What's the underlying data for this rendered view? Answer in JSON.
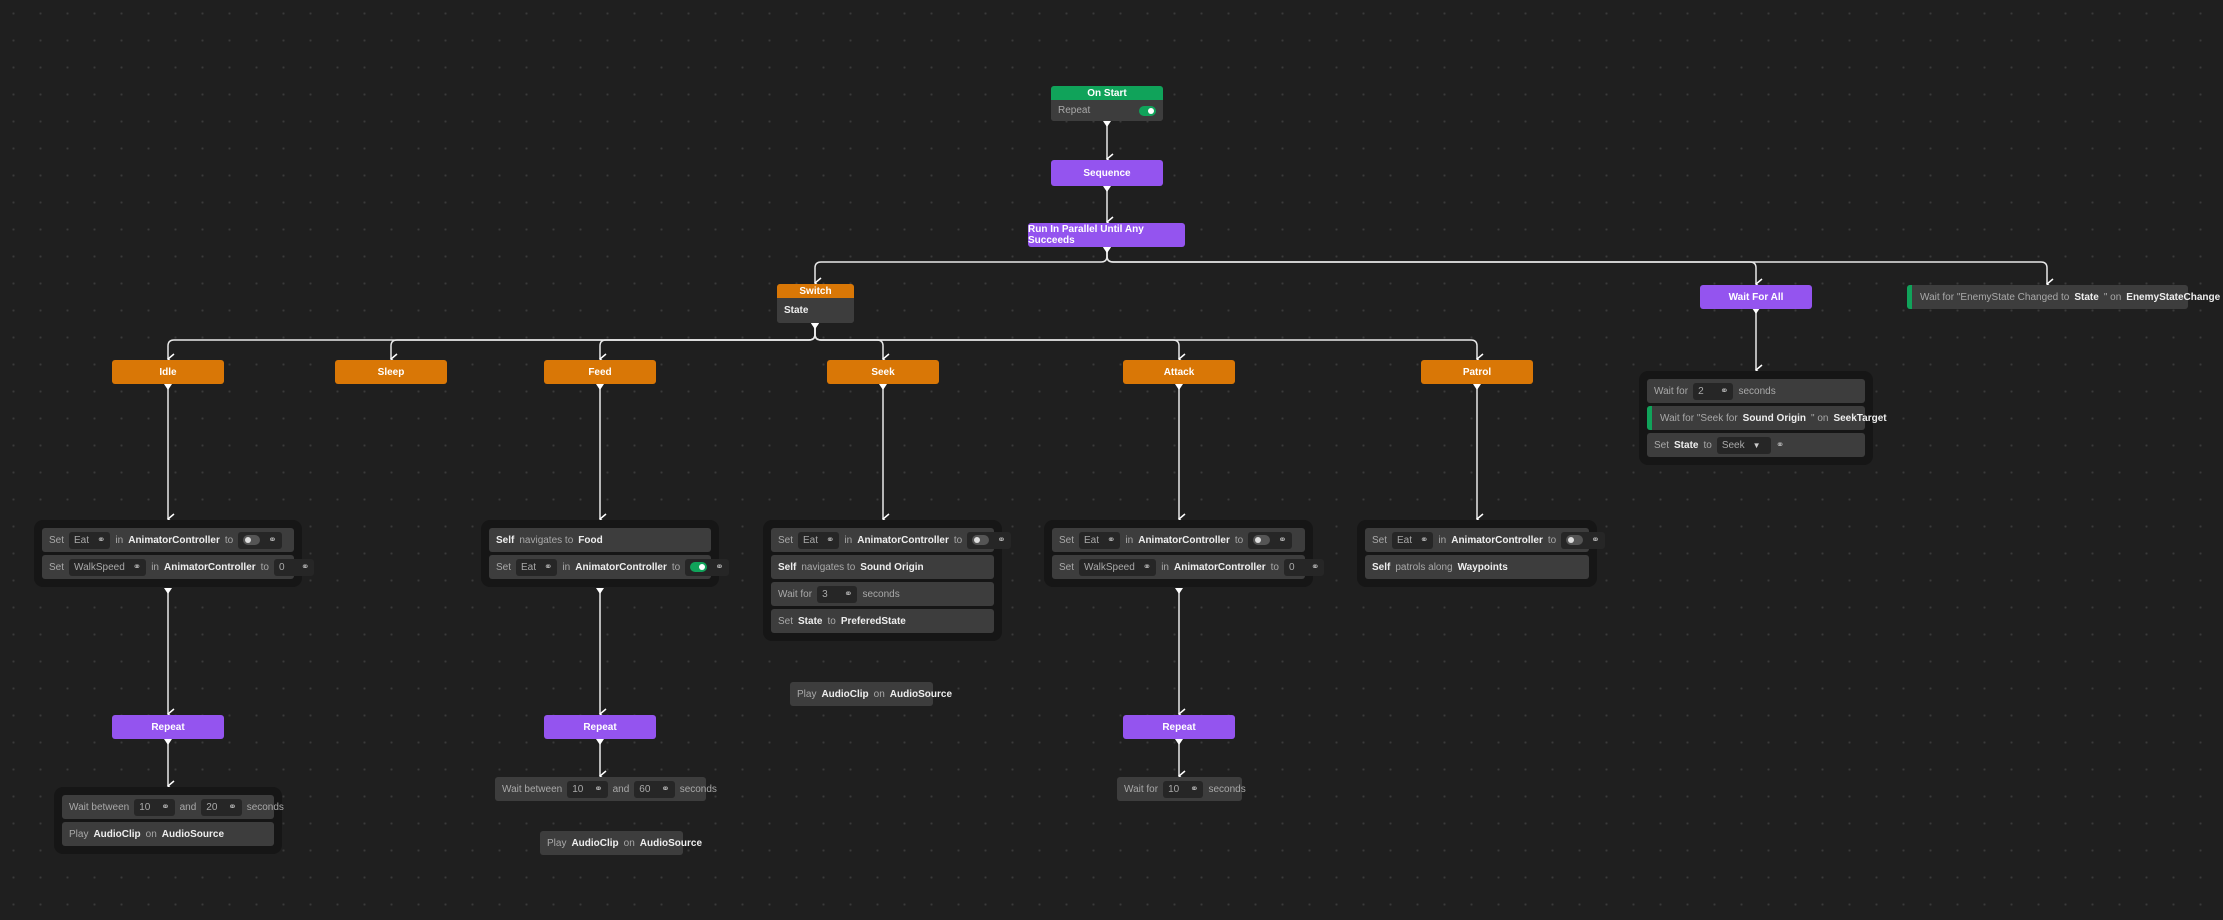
{
  "colors": {
    "sequence": "#9454ef",
    "branch": "#d97706",
    "event": "#10a35a",
    "background": "#1f1f1f"
  },
  "nodes": {
    "on_start": {
      "title": "On Start",
      "rows": [
        [
          {
            "t": "Repeat"
          },
          {
            "toggle": true
          }
        ]
      ]
    },
    "sequence": {
      "label": "Sequence"
    },
    "parallel": {
      "label": "Run In Parallel Until Any Succeeds"
    },
    "switch": {
      "title": "Switch",
      "rows": [
        [
          {
            "b": "State"
          }
        ]
      ]
    },
    "wait_for_all": {
      "label": "Wait For All"
    },
    "enemy_wait": {
      "rows": [
        [
          {
            "t": "Wait for \"EnemyState Changed to"
          },
          {
            "b": "State"
          },
          {
            "t": "\" on"
          },
          {
            "b": "EnemyStateChange"
          }
        ]
      ]
    },
    "branch_idle": {
      "label": "Idle"
    },
    "branch_sleep": {
      "label": "Sleep"
    },
    "branch_feed": {
      "label": "Feed"
    },
    "branch_seek": {
      "label": "Seek"
    },
    "branch_attack": {
      "label": "Attack"
    },
    "branch_patrol": {
      "label": "Patrol"
    },
    "idle_group": {
      "rows": [
        [
          {
            "t": "Set"
          },
          {
            "f": "Eat"
          },
          {
            "t": "in"
          },
          {
            "b": "AnimatorController"
          },
          {
            "t": "to"
          },
          {
            "ftoggle": false
          }
        ],
        [
          {
            "t": "Set"
          },
          {
            "f": "WalkSpeed"
          },
          {
            "t": "in"
          },
          {
            "b": "AnimatorController"
          },
          {
            "t": "to"
          },
          {
            "f": "0"
          }
        ]
      ]
    },
    "feed_group": {
      "rows": [
        [
          {
            "b": "Self"
          },
          {
            "t": "navigates to"
          },
          {
            "b": "Food"
          }
        ],
        [
          {
            "t": "Set"
          },
          {
            "f": "Eat"
          },
          {
            "t": "in"
          },
          {
            "b": "AnimatorController"
          },
          {
            "t": "to"
          },
          {
            "ftoggle": true
          }
        ]
      ]
    },
    "seek_group": {
      "rows": [
        [
          {
            "t": "Set"
          },
          {
            "f": "Eat"
          },
          {
            "t": "in"
          },
          {
            "b": "AnimatorController"
          },
          {
            "t": "to"
          },
          {
            "ftoggle": false
          }
        ],
        [
          {
            "b": "Self"
          },
          {
            "t": "navigates to"
          },
          {
            "b": "Sound Origin"
          }
        ],
        [
          {
            "t": "Wait for"
          },
          {
            "f": "3"
          },
          {
            "t": "seconds"
          }
        ],
        [
          {
            "t": "Set"
          },
          {
            "b": "State"
          },
          {
            "t": "to"
          },
          {
            "b": "PreferedState"
          }
        ]
      ]
    },
    "attack_group": {
      "rows": [
        [
          {
            "t": "Set"
          },
          {
            "f": "Eat"
          },
          {
            "t": "in"
          },
          {
            "b": "AnimatorController"
          },
          {
            "t": "to"
          },
          {
            "ftoggle": false
          }
        ],
        [
          {
            "t": "Set"
          },
          {
            "f": "WalkSpeed"
          },
          {
            "t": "in"
          },
          {
            "b": "AnimatorController"
          },
          {
            "t": "to"
          },
          {
            "f": "0"
          }
        ]
      ]
    },
    "patrol_group": {
      "rows": [
        [
          {
            "t": "Set"
          },
          {
            "f": "Eat"
          },
          {
            "t": "in"
          },
          {
            "b": "AnimatorController"
          },
          {
            "t": "to"
          },
          {
            "ftoggle": false
          }
        ],
        [
          {
            "b": "Self"
          },
          {
            "t": "patrols along"
          },
          {
            "b": "Waypoints"
          }
        ]
      ]
    },
    "wfa_group": {
      "rows": [
        [
          {
            "t": "Wait for"
          },
          {
            "f": "2"
          },
          {
            "t": "seconds"
          }
        ],
        [
          {
            "bar": true
          },
          {
            "t": "Wait for \"Seek for"
          },
          {
            "b": "Sound Origin"
          },
          {
            "t": "\" on"
          },
          {
            "b": "SeekTarget"
          }
        ],
        [
          {
            "t": "Set"
          },
          {
            "b": "State"
          },
          {
            "t": "to"
          },
          {
            "dd": "Seek"
          },
          {
            "link": true
          }
        ]
      ]
    },
    "repeat_idle": {
      "label": "Repeat"
    },
    "repeat_feed": {
      "label": "Repeat"
    },
    "repeat_attack": {
      "label": "Repeat"
    },
    "idle_bottom": {
      "rows": [
        [
          {
            "t": "Wait between"
          },
          {
            "f": "10"
          },
          {
            "t": "and"
          },
          {
            "f": "20"
          },
          {
            "t": "seconds"
          }
        ],
        [
          {
            "t": "Play"
          },
          {
            "b": "AudioClip"
          },
          {
            "t": "on"
          },
          {
            "b": "AudioSource"
          }
        ]
      ]
    },
    "feed_wait": {
      "rows": [
        [
          {
            "t": "Wait between"
          },
          {
            "f": "10"
          },
          {
            "t": "and"
          },
          {
            "f": "60"
          },
          {
            "t": "seconds"
          }
        ]
      ]
    },
    "feed_play": {
      "rows": [
        [
          {
            "t": "Play"
          },
          {
            "b": "AudioClip"
          },
          {
            "t": "on"
          },
          {
            "b": "AudioSource"
          }
        ]
      ]
    },
    "seek_play": {
      "rows": [
        [
          {
            "t": "Play"
          },
          {
            "b": "AudioClip"
          },
          {
            "t": "on"
          },
          {
            "b": "AudioSource"
          }
        ]
      ]
    },
    "attack_wait": {
      "rows": [
        [
          {
            "t": "Wait for"
          },
          {
            "f": "10"
          },
          {
            "t": "seconds"
          }
        ]
      ]
    }
  }
}
